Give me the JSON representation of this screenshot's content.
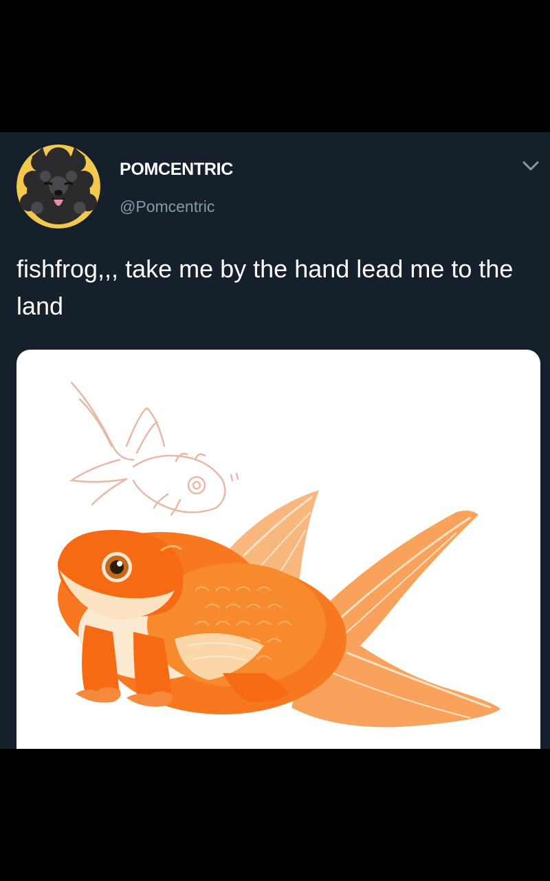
{
  "tweet": {
    "display_name": "POMCENTRIC",
    "handle": "@Pomcentric",
    "text": "fishfrog,,, take me by the hand lead me to the land",
    "menu_icon": "chevron-down-icon",
    "avatar_icon": "pomeranian-avatar",
    "media": "fishfrog-illustration"
  },
  "colors": {
    "background": "#15202b",
    "text": "#ffffff",
    "secondary_text": "#8899a6",
    "fish_orange": "#f7781e"
  }
}
